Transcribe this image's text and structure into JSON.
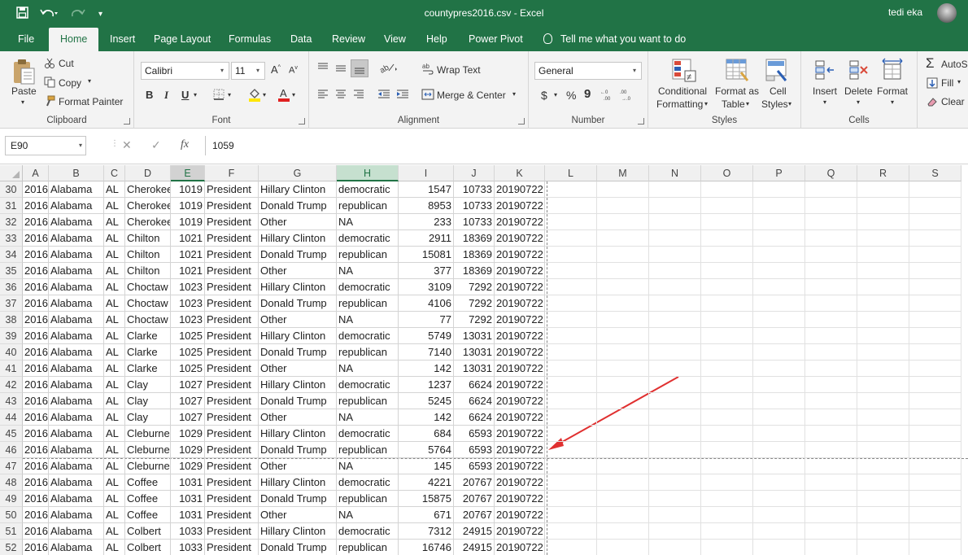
{
  "title_bar": {
    "document_title": "countypres2016.csv  -  Excel",
    "user_name": "tedi eka",
    "qat": {
      "save_icon": "save-icon",
      "undo_icon": "undo-icon",
      "redo_icon": "redo-icon",
      "customize_icon": "customize-qat-icon"
    }
  },
  "tabs": [
    {
      "label": "File",
      "active": false
    },
    {
      "label": "Home",
      "active": true
    },
    {
      "label": "Insert",
      "active": false
    },
    {
      "label": "Page Layout",
      "active": false
    },
    {
      "label": "Formulas",
      "active": false
    },
    {
      "label": "Data",
      "active": false
    },
    {
      "label": "Review",
      "active": false
    },
    {
      "label": "View",
      "active": false
    },
    {
      "label": "Help",
      "active": false
    },
    {
      "label": "Power Pivot",
      "active": false
    }
  ],
  "tell_me": "Tell me what you want to do",
  "ribbon": {
    "clipboard": {
      "label": "Clipboard",
      "paste": "Paste",
      "cut": "Cut",
      "copy": "Copy",
      "format_painter": "Format Painter"
    },
    "font": {
      "label": "Font",
      "font_name": "Calibri",
      "font_size": "11",
      "bold": "B",
      "italic": "I",
      "underline": "U"
    },
    "alignment": {
      "label": "Alignment",
      "wrap_text": "Wrap Text",
      "merge_center": "Merge & Center"
    },
    "number": {
      "label": "Number",
      "format": "General",
      "currency": "$",
      "percent": "%",
      "comma": "9"
    },
    "styles": {
      "label": "Styles",
      "conditional_formatting": "Conditional",
      "conditional_formatting_2": "Formatting",
      "format_as_table": "Format as",
      "format_as_table_2": "Table",
      "cell_styles": "Cell",
      "cell_styles_2": "Styles"
    },
    "cells": {
      "label": "Cells",
      "insert": "Insert",
      "delete": "Delete",
      "format": "Format"
    },
    "editing": {
      "autosum": "AutoS",
      "fill": "Fill",
      "clear": "Clear"
    }
  },
  "formula_bar": {
    "name_box": "E90",
    "cancel": "✕",
    "enter": "✓",
    "fx": "fx",
    "value": "1059"
  },
  "columns": [
    "A",
    "B",
    "C",
    "D",
    "E",
    "F",
    "G",
    "H",
    "I",
    "J",
    "K",
    "L",
    "M",
    "N",
    "O",
    "P",
    "Q",
    "R",
    "S"
  ],
  "rows": [
    {
      "n": "30",
      "cells": [
        "2016",
        "Alabama",
        "AL",
        "Cherokee",
        "1019",
        "President",
        "Hillary Clinton",
        "democratic",
        "1547",
        "10733",
        "20190722"
      ]
    },
    {
      "n": "31",
      "cells": [
        "2016",
        "Alabama",
        "AL",
        "Cherokee",
        "1019",
        "President",
        "Donald Trump",
        "republican",
        "8953",
        "10733",
        "20190722"
      ]
    },
    {
      "n": "32",
      "cells": [
        "2016",
        "Alabama",
        "AL",
        "Cherokee",
        "1019",
        "President",
        "Other",
        "NA",
        "233",
        "10733",
        "20190722"
      ]
    },
    {
      "n": "33",
      "cells": [
        "2016",
        "Alabama",
        "AL",
        "Chilton",
        "1021",
        "President",
        "Hillary Clinton",
        "democratic",
        "2911",
        "18369",
        "20190722"
      ]
    },
    {
      "n": "34",
      "cells": [
        "2016",
        "Alabama",
        "AL",
        "Chilton",
        "1021",
        "President",
        "Donald Trump",
        "republican",
        "15081",
        "18369",
        "20190722"
      ]
    },
    {
      "n": "35",
      "cells": [
        "2016",
        "Alabama",
        "AL",
        "Chilton",
        "1021",
        "President",
        "Other",
        "NA",
        "377",
        "18369",
        "20190722"
      ]
    },
    {
      "n": "36",
      "cells": [
        "2016",
        "Alabama",
        "AL",
        "Choctaw",
        "1023",
        "President",
        "Hillary Clinton",
        "democratic",
        "3109",
        "7292",
        "20190722"
      ]
    },
    {
      "n": "37",
      "cells": [
        "2016",
        "Alabama",
        "AL",
        "Choctaw",
        "1023",
        "President",
        "Donald Trump",
        "republican",
        "4106",
        "7292",
        "20190722"
      ]
    },
    {
      "n": "38",
      "cells": [
        "2016",
        "Alabama",
        "AL",
        "Choctaw",
        "1023",
        "President",
        "Other",
        "NA",
        "77",
        "7292",
        "20190722"
      ]
    },
    {
      "n": "39",
      "cells": [
        "2016",
        "Alabama",
        "AL",
        "Clarke",
        "1025",
        "President",
        "Hillary Clinton",
        "democratic",
        "5749",
        "13031",
        "20190722"
      ]
    },
    {
      "n": "40",
      "cells": [
        "2016",
        "Alabama",
        "AL",
        "Clarke",
        "1025",
        "President",
        "Donald Trump",
        "republican",
        "7140",
        "13031",
        "20190722"
      ]
    },
    {
      "n": "41",
      "cells": [
        "2016",
        "Alabama",
        "AL",
        "Clarke",
        "1025",
        "President",
        "Other",
        "NA",
        "142",
        "13031",
        "20190722"
      ]
    },
    {
      "n": "42",
      "cells": [
        "2016",
        "Alabama",
        "AL",
        "Clay",
        "1027",
        "President",
        "Hillary Clinton",
        "democratic",
        "1237",
        "6624",
        "20190722"
      ]
    },
    {
      "n": "43",
      "cells": [
        "2016",
        "Alabama",
        "AL",
        "Clay",
        "1027",
        "President",
        "Donald Trump",
        "republican",
        "5245",
        "6624",
        "20190722"
      ]
    },
    {
      "n": "44",
      "cells": [
        "2016",
        "Alabama",
        "AL",
        "Clay",
        "1027",
        "President",
        "Other",
        "NA",
        "142",
        "6624",
        "20190722"
      ]
    },
    {
      "n": "45",
      "cells": [
        "2016",
        "Alabama",
        "AL",
        "Cleburne",
        "1029",
        "President",
        "Hillary Clinton",
        "democratic",
        "684",
        "6593",
        "20190722"
      ]
    },
    {
      "n": "46",
      "cells": [
        "2016",
        "Alabama",
        "AL",
        "Cleburne",
        "1029",
        "President",
        "Donald Trump",
        "republican",
        "5764",
        "6593",
        "20190722"
      ]
    },
    {
      "n": "47",
      "cells": [
        "2016",
        "Alabama",
        "AL",
        "Cleburne",
        "1029",
        "President",
        "Other",
        "NA",
        "145",
        "6593",
        "20190722"
      ]
    },
    {
      "n": "48",
      "cells": [
        "2016",
        "Alabama",
        "AL",
        "Coffee",
        "1031",
        "President",
        "Hillary Clinton",
        "democratic",
        "4221",
        "20767",
        "20190722"
      ]
    },
    {
      "n": "49",
      "cells": [
        "2016",
        "Alabama",
        "AL",
        "Coffee",
        "1031",
        "President",
        "Donald Trump",
        "republican",
        "15875",
        "20767",
        "20190722"
      ]
    },
    {
      "n": "50",
      "cells": [
        "2016",
        "Alabama",
        "AL",
        "Coffee",
        "1031",
        "President",
        "Other",
        "NA",
        "671",
        "20767",
        "20190722"
      ]
    },
    {
      "n": "51",
      "cells": [
        "2016",
        "Alabama",
        "AL",
        "Colbert",
        "1033",
        "President",
        "Hillary Clinton",
        "democratic",
        "7312",
        "24915",
        "20190722"
      ]
    },
    {
      "n": "52",
      "cells": [
        "2016",
        "Alabama",
        "AL",
        "Colbert",
        "1033",
        "President",
        "Donald Trump",
        "republican",
        "16746",
        "24915",
        "20190722"
      ]
    }
  ],
  "colors": {
    "excel_green": "#217346",
    "arrow_red": "#e03030"
  }
}
